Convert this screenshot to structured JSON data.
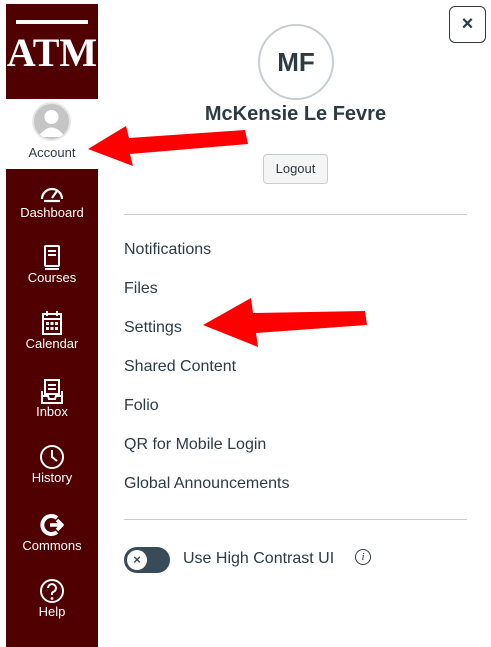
{
  "sidebar": {
    "logo": "ATM",
    "account_label": "Account",
    "items": [
      {
        "label": "Dashboard",
        "icon": "dashboard-icon"
      },
      {
        "label": "Courses",
        "icon": "courses-icon"
      },
      {
        "label": "Calendar",
        "icon": "calendar-icon"
      },
      {
        "label": "Inbox",
        "icon": "inbox-icon"
      },
      {
        "label": "History",
        "icon": "history-icon"
      },
      {
        "label": "Commons",
        "icon": "commons-icon"
      },
      {
        "label": "Help",
        "icon": "help-icon"
      }
    ]
  },
  "tray": {
    "close_label": "×",
    "avatar_initials": "MF",
    "user_name": "McKensie Le Fevre",
    "logout_label": "Logout",
    "links": [
      "Notifications",
      "Files",
      "Settings",
      "Shared Content",
      "Folio",
      "QR for Mobile Login",
      "Global Announcements"
    ],
    "high_contrast_label": "Use High Contrast UI",
    "toggle_symbol": "×",
    "info_symbol": "i"
  },
  "colors": {
    "brand": "#500000",
    "text": "#2d3b45",
    "arrow": "#ff0000"
  }
}
